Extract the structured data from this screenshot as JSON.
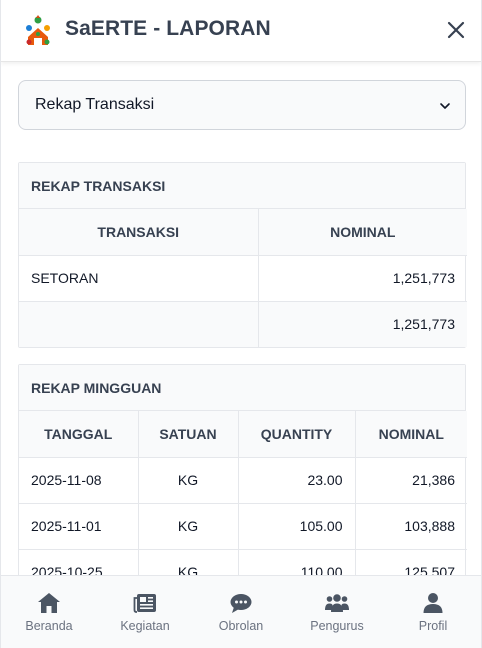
{
  "header": {
    "title": "SaERTE - LAPORAN",
    "close_icon": "close-icon",
    "logo_icon": "saerte-logo"
  },
  "report_select": {
    "value": "Rekap Transaksi",
    "icon": "chevron-down-icon"
  },
  "rekap_transaksi": {
    "title": "REKAP TRANSAKSI",
    "columns": [
      "TRANSAKSI",
      "NOMINAL"
    ],
    "rows": [
      {
        "transaksi": "SETORAN",
        "nominal": "1,251,773"
      }
    ],
    "total": {
      "transaksi": "",
      "nominal": "1,251,773"
    }
  },
  "rekap_mingguan": {
    "title": "REKAP MINGGUAN",
    "columns": [
      "TANGGAL",
      "SATUAN",
      "QUANTITY",
      "NOMINAL"
    ],
    "rows": [
      {
        "tanggal": "2025-11-08",
        "satuan": "KG",
        "quantity": "23.00",
        "nominal": "21,386"
      },
      {
        "tanggal": "2025-11-01",
        "satuan": "KG",
        "quantity": "105.00",
        "nominal": "103,888"
      },
      {
        "tanggal": "2025-10-25",
        "satuan": "KG",
        "quantity": "110.00",
        "nominal": "125,507"
      }
    ]
  },
  "bottom_nav": {
    "items": [
      {
        "label": "Beranda",
        "icon": "home-icon"
      },
      {
        "label": "Kegiatan",
        "icon": "newspaper-icon"
      },
      {
        "label": "Obrolan",
        "icon": "chat-icon"
      },
      {
        "label": "Pengurus",
        "icon": "users-icon"
      },
      {
        "label": "Profil",
        "icon": "user-icon"
      }
    ]
  },
  "colors": {
    "icon_gray": "#4b5563",
    "text_dark": "#374151",
    "border": "#e5e7eb",
    "header_bg": "#ffffff",
    "panel_bg": "#f9fafb"
  }
}
